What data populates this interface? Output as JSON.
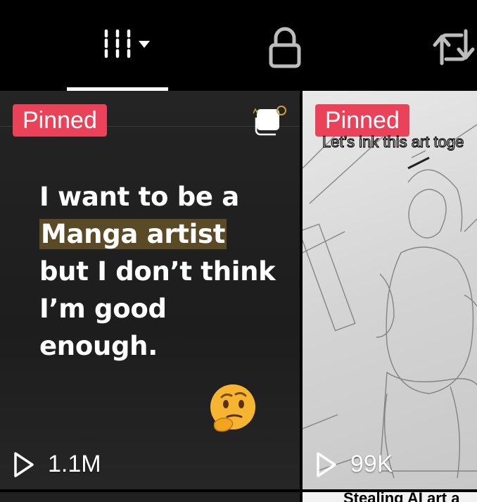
{
  "tabs": [
    {
      "name": "videos",
      "icon": "grid-lines-icon",
      "has_dropdown": true,
      "active": true
    },
    {
      "name": "private",
      "icon": "lock-icon",
      "active": false
    },
    {
      "name": "reposts",
      "icon": "repost-icon",
      "active": false
    }
  ],
  "videos": [
    {
      "pinned_label": "Pinned",
      "views": "1.1M",
      "headline_before": "I want to be a",
      "headline_highlight": "Manga artist",
      "headline_after": "but I don’t think I’m good enough.",
      "emoji": "thinking-face",
      "highlight_color": "#5a4a25"
    },
    {
      "pinned_label": "Pinned",
      "views": "99K",
      "caption": "Let’s ink this art toge"
    },
    {
      "caption": "Stealing AI art a"
    }
  ],
  "colors": {
    "background": "#000000",
    "pinned_badge": "#ea4359",
    "text": "#ffffff"
  }
}
